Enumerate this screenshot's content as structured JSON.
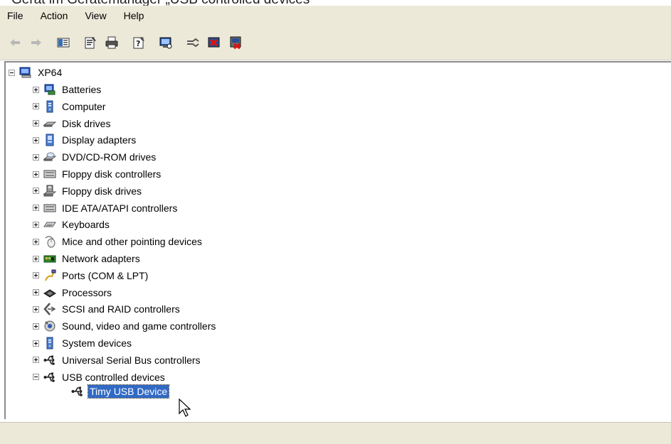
{
  "caption_fragment": "Gerät im Gerätemanager „USB controlled devices“",
  "menu": [
    "File",
    "Action",
    "View",
    "Help"
  ],
  "toolbar": {
    "icons": [
      "back-arrow-icon",
      "forward-arrow-icon",
      "show-hide-console-tree-icon",
      "properties-icon",
      "print-icon",
      "help-icon",
      "scan-hardware-changes-icon",
      "update-driver-icon",
      "disable-device-icon",
      "uninstall-device-icon"
    ]
  },
  "tree": {
    "root": "XP64",
    "categories": [
      {
        "label": "Batteries",
        "icon": "battery-icon",
        "expanded": false
      },
      {
        "label": "Computer",
        "icon": "computer-icon",
        "expanded": false
      },
      {
        "label": "Disk drives",
        "icon": "disk-drive-icon",
        "expanded": false
      },
      {
        "label": "Display adapters",
        "icon": "display-adapter-icon",
        "expanded": false
      },
      {
        "label": "DVD/CD-ROM drives",
        "icon": "dvd-drive-icon",
        "expanded": false
      },
      {
        "label": "Floppy disk controllers",
        "icon": "floppy-controller-icon",
        "expanded": false
      },
      {
        "label": "Floppy disk drives",
        "icon": "floppy-drive-icon",
        "expanded": false
      },
      {
        "label": "IDE ATA/ATAPI controllers",
        "icon": "ide-controller-icon",
        "expanded": false
      },
      {
        "label": "Keyboards",
        "icon": "keyboard-icon",
        "expanded": false
      },
      {
        "label": "Mice and other pointing devices",
        "icon": "mouse-icon",
        "expanded": false
      },
      {
        "label": "Network adapters",
        "icon": "network-adapter-icon",
        "expanded": false
      },
      {
        "label": "Ports (COM & LPT)",
        "icon": "port-icon",
        "expanded": false
      },
      {
        "label": "Processors",
        "icon": "processor-icon",
        "expanded": false
      },
      {
        "label": "SCSI and RAID controllers",
        "icon": "scsi-controller-icon",
        "expanded": false
      },
      {
        "label": "Sound, video and game controllers",
        "icon": "sound-icon",
        "expanded": false
      },
      {
        "label": "System devices",
        "icon": "system-device-icon",
        "expanded": false
      },
      {
        "label": "Universal Serial Bus controllers",
        "icon": "usb-icon",
        "expanded": false
      },
      {
        "label": "USB controlled devices",
        "icon": "usb-icon",
        "expanded": true
      }
    ],
    "child": {
      "label": "Timy USB Device",
      "icon": "usb-icon",
      "selected": true
    }
  },
  "colors": {
    "chrome": "#ece9d8",
    "selection": "#316ac5",
    "selection_text": "#ffffff"
  }
}
